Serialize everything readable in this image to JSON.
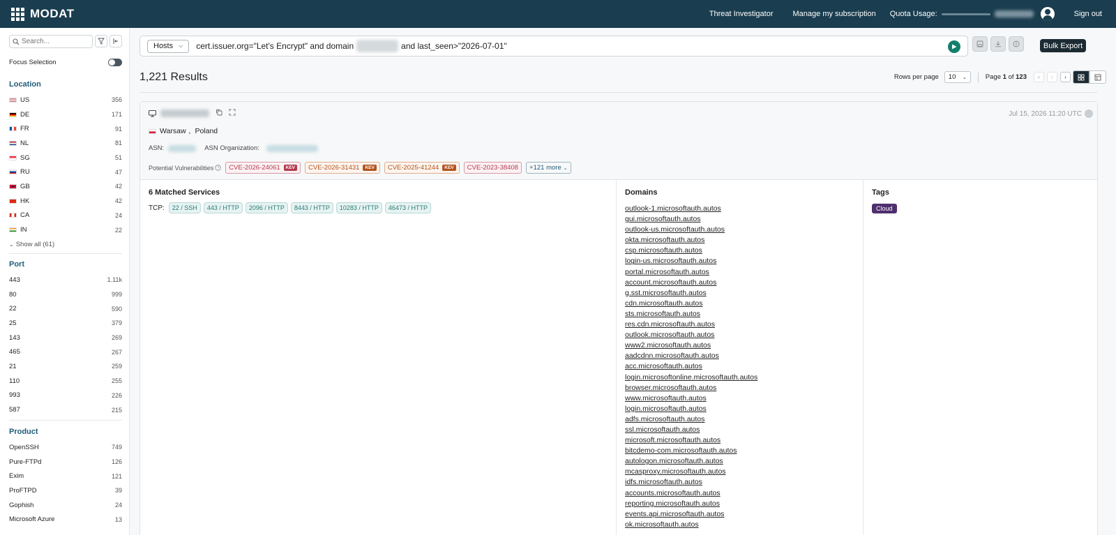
{
  "app": {
    "logo_text": "MODAT"
  },
  "topnav": {
    "threat_investigator": "Threat Investigator",
    "manage_subscription": "Manage my subscription",
    "quota_label": "Quota Usage:",
    "sign_out": "Sign out"
  },
  "sidebar": {
    "search_placeholder": "Search...",
    "focus_selection": "Focus Selection",
    "location": {
      "title": "Location",
      "items": [
        {
          "code": "US",
          "count": "356"
        },
        {
          "code": "DE",
          "count": "171"
        },
        {
          "code": "FR",
          "count": "91"
        },
        {
          "code": "NL",
          "count": "81"
        },
        {
          "code": "SG",
          "count": "51"
        },
        {
          "code": "RU",
          "count": "47"
        },
        {
          "code": "GB",
          "count": "42"
        },
        {
          "code": "HK",
          "count": "42"
        },
        {
          "code": "CA",
          "count": "24"
        },
        {
          "code": "IN",
          "count": "22"
        }
      ],
      "show_all": "Show all (61)"
    },
    "port": {
      "title": "Port",
      "items": [
        {
          "port": "443",
          "count": "1.11k"
        },
        {
          "port": "80",
          "count": "999"
        },
        {
          "port": "22",
          "count": "590"
        },
        {
          "port": "25",
          "count": "379"
        },
        {
          "port": "143",
          "count": "269"
        },
        {
          "port": "465",
          "count": "267"
        },
        {
          "port": "21",
          "count": "259"
        },
        {
          "port": "110",
          "count": "255"
        },
        {
          "port": "993",
          "count": "226"
        },
        {
          "port": "587",
          "count": "215"
        }
      ]
    },
    "product": {
      "title": "Product",
      "items": [
        {
          "name": "OpenSSH",
          "count": "749"
        },
        {
          "name": "Pure-FTPd",
          "count": "126"
        },
        {
          "name": "Exim",
          "count": "121"
        },
        {
          "name": "ProFTPD",
          "count": "39"
        },
        {
          "name": "Gophish",
          "count": "24"
        },
        {
          "name": "Microsoft Azure",
          "count": "13"
        }
      ]
    }
  },
  "query": {
    "type": "Hosts",
    "part1": "cert.issuer.org=\"Let's Encrypt\" and domain",
    "part2": "and last_seen>\"2026-07-01\""
  },
  "toolbar": {
    "bulk_export": "Bulk Export"
  },
  "results": {
    "count": "1,221",
    "label": "Results",
    "rows_per_page_label": "Rows per page",
    "rows_per_page": "10",
    "page_label": "Page",
    "page_current": "1",
    "page_of": "of",
    "page_total": "123"
  },
  "host": {
    "date": "Jul 15, 2026 11:20 UTC",
    "city": "Warsaw",
    "geo_sep": ",",
    "country": "Poland",
    "asn_label": "ASN:",
    "asn_org_label": "ASN Organization:",
    "vuln_label": "Potential Vulnerabilities",
    "cves": [
      {
        "id": "CVE-2026-24061",
        "kev": "KEV"
      },
      {
        "id": "CVE-2026-31431",
        "kev": "KEV"
      },
      {
        "id": "CVE-2025-41244",
        "kev": "KEV"
      },
      {
        "id": "CVE-2023-38408"
      }
    ],
    "more": "+121 more"
  },
  "services": {
    "title": "6 Matched Services",
    "tcp_label": "TCP:",
    "items": [
      "22 / SSH",
      "443 / HTTP",
      "2096 / HTTP",
      "8443 / HTTP",
      "10283 / HTTP",
      "46473 / HTTP"
    ]
  },
  "domains": {
    "title": "Domains",
    "items": [
      "outlook-1.microsoftauth.autos",
      "gui.microsoftauth.autos",
      "outlook-us.microsoftauth.autos",
      "okta.microsoftauth.autos",
      "csp.microsoftauth.autos",
      "login-us.microsoftauth.autos",
      "portal.microsoftauth.autos",
      "account.microsoftauth.autos",
      "g.sst.microsoftauth.autos",
      "cdn.microsoftauth.autos",
      "sts.microsoftauth.autos",
      "res.cdn.microsoftauth.autos",
      "outlook.microsoftauth.autos",
      "www2.microsoftauth.autos",
      "aadcdnn.microsoftauth.autos",
      "acc.microsoftauth.autos",
      "login.microsoftonline.microsoftauth.autos",
      "browser.microsoftauth.autos",
      "www.microsoftauth.autos",
      "login.microsoftauth.autos",
      "adfs.microsoftauth.autos",
      "ssl.microsoftauth.autos",
      "microsoft.microsoftauth.autos",
      "bitcdemo-com.microsoftauth.autos",
      "autologon.microsoftauth.autos",
      "mcasproxy.microsoftauth.autos",
      "idfs.microsoftauth.autos",
      "accounts.microsoftauth.autos",
      "reporting.microsoftauth.autos",
      "events.api.microsoftauth.autos",
      "ok.microsoftauth.autos"
    ]
  },
  "tags": {
    "title": "Tags",
    "items": [
      "Cloud"
    ]
  },
  "colors": {
    "topbar": "#1a3d4f",
    "accent": "#1f5c7a",
    "run_button": "#12806c",
    "kev_red": "#b43a4e",
    "tag_purple": "#4f2f6e"
  }
}
